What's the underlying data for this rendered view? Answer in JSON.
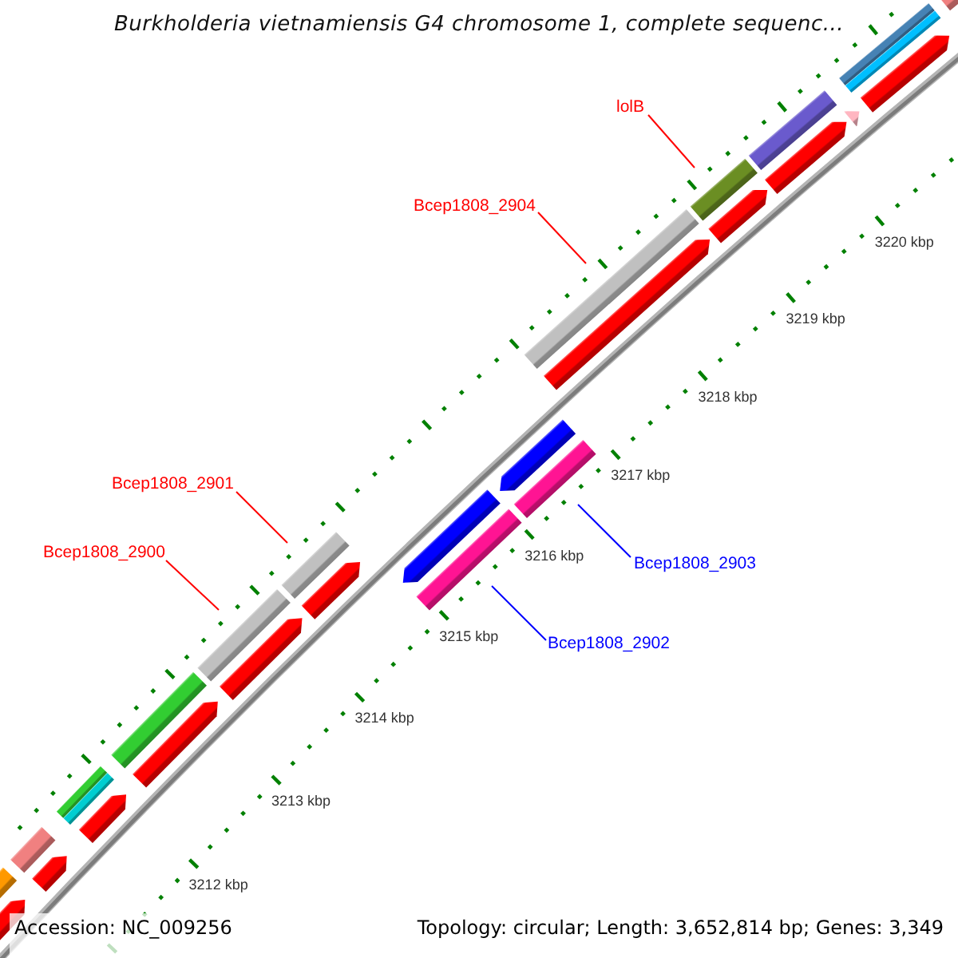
{
  "title": "Burkholderia vietnamiensis G4 chromosome 1, complete sequenc...",
  "map": {
    "cog_forward": [
      {
        "kind": "single",
        "color": "#ff9900"
      },
      {
        "kind": "single",
        "color": "#f08080"
      },
      {
        "kind": "split",
        "halves": [
          {
            "color": "#32cd32"
          },
          {
            "color": "#00ced1"
          }
        ]
      },
      {
        "kind": "single",
        "color": "#32cd32"
      },
      {
        "kind": "single",
        "color": "#c0c0c0"
      },
      {
        "kind": "single",
        "color": "#c0c0c0"
      },
      {
        "kind": "single",
        "color": "#c0c0c0"
      },
      {
        "kind": "single",
        "color": "#6b8e23"
      },
      {
        "kind": "single",
        "color": "#6a5acd"
      },
      {
        "kind": "split",
        "halves": [
          {
            "color": "#4682b4"
          },
          {
            "color": "#00bfff"
          }
        ]
      },
      {
        "kind": "single",
        "color": "#f08080"
      }
    ],
    "cds_forward": [
      {
        "color": "#ff0000"
      },
      {
        "color": "#ff0000"
      },
      {
        "color": "#ff0000"
      },
      {
        "color": "#ff0000"
      },
      {
        "color": "#ff0000"
      },
      {
        "color": "#ff0000"
      },
      {
        "color": "#ff0000"
      },
      {
        "color": "#ff0000"
      },
      {
        "color": "#ff0000"
      },
      {
        "color": "#ffb6c1"
      },
      {
        "color": "#ff0000"
      }
    ],
    "cds_reverse": [
      {
        "color": "#0000ff"
      },
      {
        "color": "#0000ff"
      }
    ],
    "cog_reverse": [
      {
        "color": "#ff1493"
      },
      {
        "color": "#ff1493"
      }
    ],
    "gene_labels": [
      {
        "text": "lolB",
        "color": "#ff0000"
      },
      {
        "text": "Bcep1808_2904",
        "color": "#ff0000"
      },
      {
        "text": "Bcep1808_2901",
        "color": "#ff0000"
      },
      {
        "text": "Bcep1808_2900",
        "color": "#ff0000"
      },
      {
        "text": "Bcep1808_2903",
        "color": "#0000ff"
      },
      {
        "text": "Bcep1808_2902",
        "color": "#0000ff"
      }
    ],
    "tick_labels": [
      "3220 kbp",
      "3219 kbp",
      "3218 kbp",
      "3217 kbp",
      "3216 kbp",
      "3215 kbp",
      "3214 kbp",
      "3213 kbp",
      "3212 kbp"
    ]
  },
  "legend": {
    "accession": "Accession: NC_009256",
    "summary": "Topology: circular; Length: 3,652,814 bp; Genes: 3,349"
  }
}
